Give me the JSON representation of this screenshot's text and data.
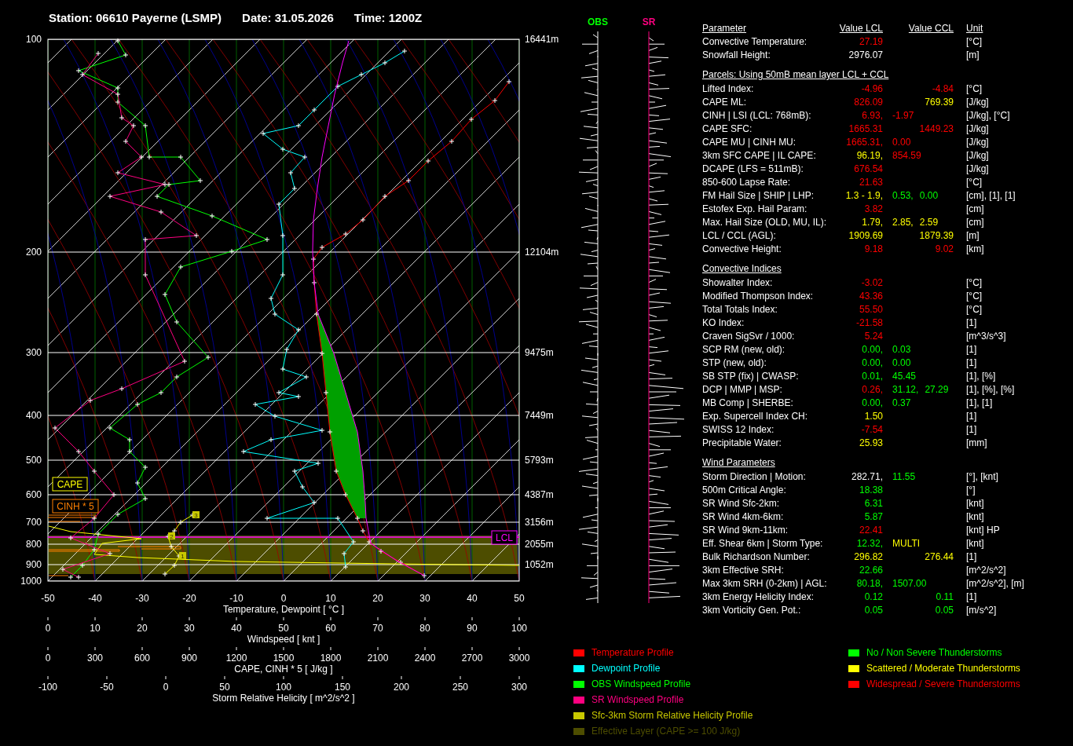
{
  "title": {
    "station": "Station: 06610 Payerne (LSMP)",
    "date": "Date: 31.05.2026",
    "time": "Time: 1200Z"
  },
  "diagram": {
    "pressure_labels": [
      "100",
      "200",
      "300",
      "400",
      "500",
      "600",
      "700",
      "800",
      "900",
      "1000"
    ],
    "height_labels": [
      "16441m",
      "12104m",
      "9475m",
      "7449m",
      "5793m",
      "4387m",
      "3156m",
      "2055m",
      "1052m"
    ],
    "boxes": [
      {
        "kind": "cape",
        "label": "CAPE"
      },
      {
        "kind": "cinh",
        "label": "CINH * 5"
      },
      {
        "kind": "lcl",
        "label": "LCL"
      }
    ],
    "srh_markers": [
      "3",
      "2",
      "1"
    ],
    "axes": [
      {
        "title": "Temperature, Dewpoint [ °C ]",
        "ticks": [
          "-50",
          "-40",
          "-30",
          "-20",
          "-10",
          "0",
          "10",
          "20",
          "30",
          "40",
          "50"
        ]
      },
      {
        "title": "Windspeed [ knt ]",
        "ticks": [
          "0",
          "10",
          "20",
          "30",
          "40",
          "50",
          "60",
          "70",
          "80",
          "90",
          "100"
        ]
      },
      {
        "title": "CAPE, CINH * 5 [ J/kg ]",
        "ticks": [
          "0",
          "300",
          "600",
          "900",
          "1200",
          "1500",
          "1800",
          "2100",
          "2400",
          "2700",
          "3000"
        ]
      },
      {
        "title": "Storm Relative Helicity [ m^2/s^2 ]",
        "ticks": [
          "-100",
          "-50",
          "0",
          "50",
          "100",
          "150",
          "200",
          "250",
          "300"
        ]
      }
    ]
  },
  "wind_columns": [
    {
      "label": "OBS",
      "color": "#00ff00"
    },
    {
      "label": "SR",
      "color": "#ff0080"
    }
  ],
  "table": {
    "headers": [
      "Parameter",
      "Value LCL",
      "Value CCL",
      "Unit"
    ],
    "sections": [
      {
        "rows": [
          {
            "label": "Convective Temperature:",
            "lcl": {
              "text": "27.19",
              "color": "#ff0000"
            },
            "unit": "[°C]"
          },
          {
            "label": "Snowfall Height:",
            "lcl": {
              "text": "2976.07",
              "color": "#ffffff"
            },
            "unit": "[m]"
          }
        ]
      },
      {
        "title": "Parcels: Using 50mB mean layer LCL + CCL",
        "rows": [
          {
            "label": "Lifted Index:",
            "lcl": {
              "text": "-4.96",
              "color": "#ff0000"
            },
            "ccl": {
              "text": "-4.84",
              "color": "#ff0000"
            },
            "unit": "[°C]"
          },
          {
            "label": "CAPE ML:",
            "lcl": {
              "text": "826.09",
              "color": "#ff0000"
            },
            "ccl": {
              "text": "769.39",
              "color": "#ffff00"
            },
            "unit": "[J/kg]"
          },
          {
            "label": "CINH | LSI (LCL: 768mB):",
            "lcl": {
              "text": "6.93,",
              "color": "#ff0000"
            },
            "extra": [
              {
                "text": "-1.97",
                "color": "#ff0000"
              }
            ],
            "unit": "[J/kg], [°C]"
          },
          {
            "label": "CAPE SFC:",
            "lcl": {
              "text": "1665.31",
              "color": "#ff0000"
            },
            "ccl": {
              "text": "1449.23",
              "color": "#ff0000"
            },
            "unit": "[J/kg]"
          },
          {
            "label": "CAPE MU | CINH MU:",
            "lcl": {
              "text": "1665.31,",
              "color": "#ff0000"
            },
            "extra": [
              {
                "text": "0.00",
                "color": "#ff0000"
              }
            ],
            "unit": "[J/kg]"
          },
          {
            "label": "3km SFC CAPE | IL CAPE:",
            "lcl": {
              "text": "96.19,",
              "color": "#ffff00"
            },
            "extra": [
              {
                "text": "854.59",
                "color": "#ff0000"
              }
            ],
            "unit": "[J/kg]"
          },
          {
            "label": "DCAPE (LFS = 511mB):",
            "lcl": {
              "text": "676.54",
              "color": "#ff0000"
            },
            "unit": "[J/kg]"
          },
          {
            "label": "850-600 Lapse Rate:",
            "lcl": {
              "text": "21.63",
              "color": "#ff0000"
            },
            "unit": "[°C]"
          },
          {
            "label": "FM Hail Size | SHIP | LHP:",
            "lcl": {
              "text": "1.3 - 1.9,",
              "color": "#ffff00"
            },
            "extra": [
              {
                "text": "0.53,",
                "color": "#00ff00"
              },
              {
                "text": "0.00",
                "color": "#00ff00"
              }
            ],
            "unit": "[cm], [1], [1]"
          },
          {
            "label": "Estofex Exp. Hail Param:",
            "lcl": {
              "text": "3.82",
              "color": "#ff0000"
            },
            "unit": "[cm]"
          },
          {
            "label": "Max. Hail Size (OLD, MU, IL):",
            "lcl": {
              "text": "1.79,",
              "color": "#ffff00"
            },
            "extra": [
              {
                "text": "2.85,",
                "color": "#ffff00"
              },
              {
                "text": "2.59",
                "color": "#ffff00"
              }
            ],
            "unit": "[cm]"
          },
          {
            "label": "LCL / CCL (AGL):",
            "lcl": {
              "text": "1909.69",
              "color": "#ffff00"
            },
            "ccl": {
              "text": "1879.39",
              "color": "#ffff00"
            },
            "unit": "[m]"
          },
          {
            "label": "Convective Height:",
            "lcl": {
              "text": "9.18",
              "color": "#ff0000"
            },
            "ccl": {
              "text": "9.02",
              "color": "#ff0000"
            },
            "unit": "[km]"
          }
        ]
      },
      {
        "title": "Convective Indices",
        "rows": [
          {
            "label": "Showalter Index:",
            "lcl": {
              "text": "-3.02",
              "color": "#ff0000"
            },
            "unit": "[°C]"
          },
          {
            "label": "Modified Thompson Index:",
            "lcl": {
              "text": "43.36",
              "color": "#ff0000"
            },
            "unit": "[°C]"
          },
          {
            "label": "Total Totals Index:",
            "lcl": {
              "text": "55.50",
              "color": "#ff0000"
            },
            "unit": "[°C]"
          },
          {
            "label": "KO Index:",
            "lcl": {
              "text": "-21.58",
              "color": "#ff0000"
            },
            "unit": "[1]"
          },
          {
            "label": "Craven SigSvr / 1000:",
            "lcl": {
              "text": "5.24",
              "color": "#ff0000"
            },
            "unit": "[m^3/s^3]"
          },
          {
            "label": "SCP RM (new, old):",
            "lcl": {
              "text": "0.00,",
              "color": "#00ff00"
            },
            "extra": [
              {
                "text": "0.03",
                "color": "#00ff00"
              }
            ],
            "unit": "[1]"
          },
          {
            "label": "STP (new, old):",
            "lcl": {
              "text": "0.00,",
              "color": "#00ff00"
            },
            "extra": [
              {
                "text": "0.00",
                "color": "#00ff00"
              }
            ],
            "unit": "[1]"
          },
          {
            "label": "SB STP (fix) | CWASP:",
            "lcl": {
              "text": "0.01,",
              "color": "#00ff00"
            },
            "extra": [
              {
                "text": "45.45",
                "color": "#00ff00"
              }
            ],
            "unit": "[1], [%]"
          },
          {
            "label": "DCP | MMP | MSP:",
            "lcl": {
              "text": "0.26,",
              "color": "#ff0000"
            },
            "extra": [
              {
                "text": "31.12,",
                "color": "#00ff00"
              },
              {
                "text": "27.29",
                "color": "#00ff00"
              }
            ],
            "unit": "[1], [%], [%]"
          },
          {
            "label": "MB Comp | SHERBE:",
            "lcl": {
              "text": "0.00,",
              "color": "#00ff00"
            },
            "extra": [
              {
                "text": "0.37",
                "color": "#00ff00"
              }
            ],
            "unit": "[1], [1]"
          },
          {
            "label": "Exp. Supercell Index CH:",
            "lcl": {
              "text": "1.50",
              "color": "#ffff00"
            },
            "unit": "[1]"
          },
          {
            "label": "SWISS 12 Index:",
            "lcl": {
              "text": "-7.54",
              "color": "#ff0000"
            },
            "unit": "[1]"
          },
          {
            "label": "Precipitable Water:",
            "lcl": {
              "text": "25.93",
              "color": "#ffff00"
            },
            "unit": "[mm]"
          }
        ]
      },
      {
        "title": "Wind Parameters",
        "rows": [
          {
            "label": "Storm Direction | Motion:",
            "lcl": {
              "text": "282.71,",
              "color": "#ffffff"
            },
            "extra": [
              {
                "text": "11.55",
                "color": "#00ff00"
              }
            ],
            "unit": "[°], [knt]"
          },
          {
            "label": "500m Critical Angle:",
            "lcl": {
              "text": "18.38",
              "color": "#00ff00"
            },
            "unit": "[°]"
          },
          {
            "label": "SR Wind Sfc-2km:",
            "lcl": {
              "text": "6.31",
              "color": "#00ff00"
            },
            "unit": "[knt]"
          },
          {
            "label": "SR Wind 4km-6km:",
            "lcl": {
              "text": "5.87",
              "color": "#00ff00"
            },
            "unit": "[knt]"
          },
          {
            "label": "SR Wind 9km-11km:",
            "lcl": {
              "text": "22.41",
              "color": "#ff0000"
            },
            "unit": "[knt] HP"
          },
          {
            "label": "Eff. Shear 6km | Storm Type:",
            "lcl": {
              "text": "12.32,",
              "color": "#00ff00"
            },
            "extra": [
              {
                "text": "MULTI",
                "color": "#ffff00"
              }
            ],
            "unit": "[knt]"
          },
          {
            "label": "Bulk Richardson Number:",
            "lcl": {
              "text": "296.82",
              "color": "#ffff00"
            },
            "ccl": {
              "text": "276.44",
              "color": "#ffff00"
            },
            "unit": "[1]"
          },
          {
            "label": "3km Effective SRH:",
            "lcl": {
              "text": "22.66",
              "color": "#00ff00"
            },
            "unit": "[m^2/s^2]"
          },
          {
            "label": "Max 3km SRH (0-2km) | AGL:",
            "lcl": {
              "text": "80.18,",
              "color": "#00ff00"
            },
            "extra": [
              {
                "text": "1507.00",
                "color": "#00ff00"
              }
            ],
            "unit": "[m^2/s^2], [m]"
          },
          {
            "label": "3km Energy Helicity Index:",
            "lcl": {
              "text": "0.12",
              "color": "#00ff00"
            },
            "ccl": {
              "text": "0.11",
              "color": "#00ff00"
            },
            "unit": "[1]"
          },
          {
            "label": "3km Vorticity Gen. Pot.:",
            "lcl": {
              "text": "0.05",
              "color": "#00ff00"
            },
            "ccl": {
              "text": "0.05",
              "color": "#00ff00"
            },
            "unit": "[m/s^2]"
          }
        ]
      }
    ]
  },
  "legend": {
    "profiles": [
      {
        "label": "Temperature Profile",
        "color": "#ff0000"
      },
      {
        "label": "Dewpoint Profile",
        "color": "#00ffff"
      },
      {
        "label": "OBS Windspeed Profile",
        "color": "#00ff00"
      },
      {
        "label": "SR Windspeed Profile",
        "color": "#ff0080"
      },
      {
        "label": "Sfc-3km Storm Relative Helicity Profile",
        "color": "#c8c800"
      },
      {
        "label": "Effective Layer (CAPE >= 100 J/kg)",
        "color": "#4d4d00"
      }
    ],
    "categories": [
      {
        "label": "No / Non Severe Thunderstorms",
        "color": "#00ff00"
      },
      {
        "label": "Scattered / Moderate Thunderstorms",
        "color": "#ffff00"
      },
      {
        "label": "Widespread / Severe Thunderstorms",
        "color": "#ff0000"
      }
    ]
  }
}
